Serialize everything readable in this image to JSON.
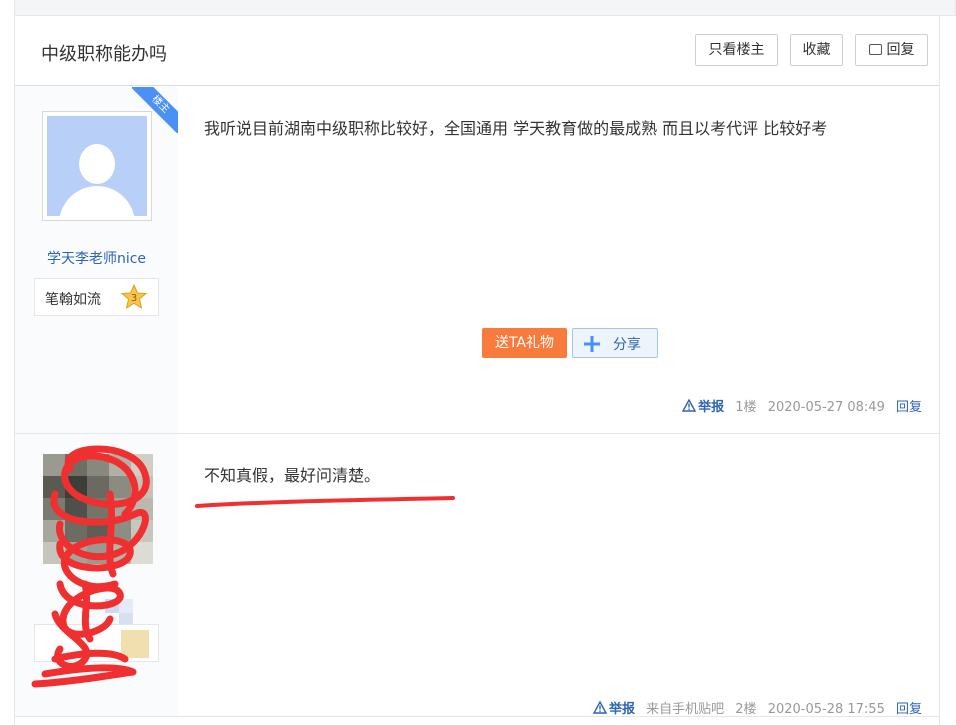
{
  "thread": {
    "title": "中级职称能办吗",
    "only_op_label": "只看楼主",
    "favorite_label": "收藏",
    "reply_label": "回复"
  },
  "posts": [
    {
      "badge": "楼主",
      "username": "学天李老师nice",
      "level_name": "笔翰如流",
      "level_number": "3",
      "content": "我听说目前湖南中级职称比较好，全国通用 学天教育做的最成熟 而且以考代评 比较好考",
      "gift_label": "送TA礼物",
      "share_label": "分享",
      "report_label": "举报",
      "floor": "1楼",
      "time": "2020-05-27 08:49",
      "reply_label": "回复"
    },
    {
      "content": "不知真假，最好问清楚。",
      "report_label": "举报",
      "source": "来自手机贴吧",
      "floor": "2楼",
      "time": "2020-05-28 17:55",
      "reply_label": "回复"
    }
  ],
  "colors": {
    "link": "#2d64b3",
    "gift": "#f97a3d",
    "badge": "#4a90f5",
    "scribble": "#f03030"
  }
}
